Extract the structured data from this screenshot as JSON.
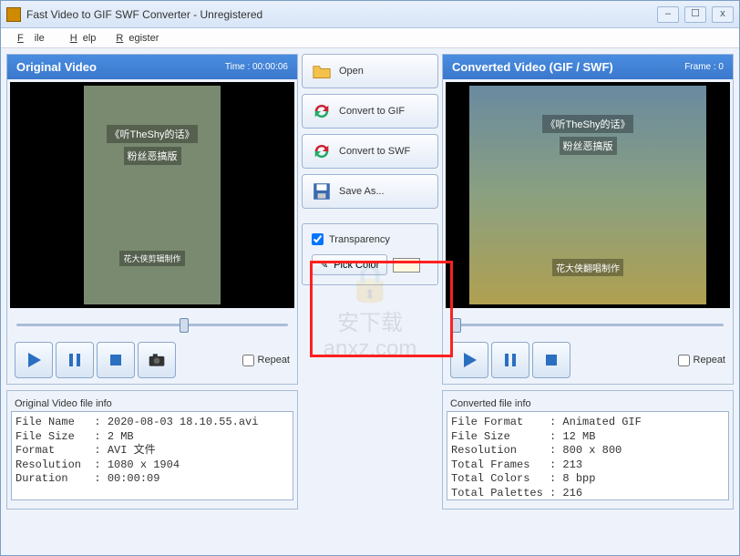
{
  "window": {
    "title": "Fast Video to GIF SWF Converter - Unregistered"
  },
  "menu": {
    "file": "File",
    "help": "Help",
    "register": "Register"
  },
  "left": {
    "header": "Original Video",
    "time_label": "Time : 00:00:06",
    "repeat": "Repeat",
    "info_title": "Original Video file info",
    "info_text": "File Name   : 2020-08-03 18.10.55.avi\nFile Size   : 2 MB\nFormat      : AVI 文件\nResolution  : 1080 x 1904\nDuration    : 00:00:09"
  },
  "right": {
    "header": "Converted Video (GIF / SWF)",
    "frame_label": "Frame : 0",
    "repeat": "Repeat",
    "info_title": "Converted file info",
    "info_text": "File Format    : Animated GIF\nFile Size      : 12 MB\nResolution     : 800 x 800\nTotal Frames   : 213\nTotal Colors   : 8 bpp\nTotal Palettes : 216"
  },
  "middle": {
    "open": "Open",
    "to_gif": "Convert to GIF",
    "to_swf": "Convert to SWF",
    "save_as": "Save As...",
    "transparency": "Transparency",
    "pick_color": "Pick Color"
  },
  "video_overlay": {
    "title1": "《听TheShy的话》",
    "title2": "粉丝恶搞版",
    "caption_left": "花大侠剪辑制作",
    "caption_right": "花大侠翻唱制作"
  },
  "watermark": {
    "text1": "安下载",
    "text2": "anxz.com"
  }
}
